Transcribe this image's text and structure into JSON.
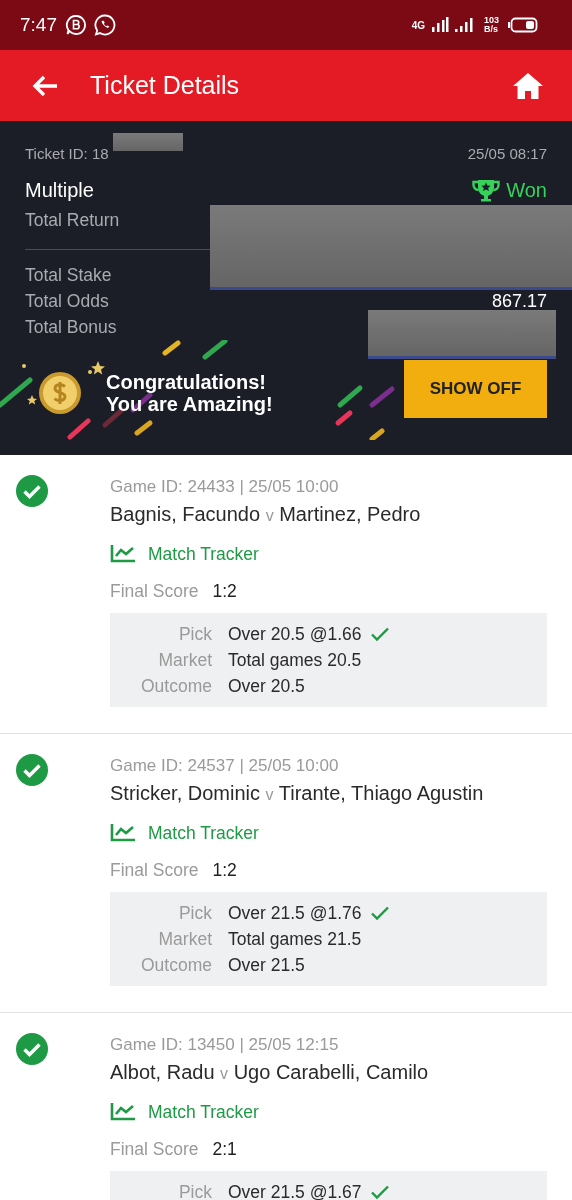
{
  "status_bar": {
    "time": "7:47",
    "network": "4G",
    "speed": {
      "value": "103",
      "unit": "B/s"
    }
  },
  "header": {
    "title": "Ticket Details"
  },
  "ticket": {
    "id": {
      "text": "Ticket ID: 18",
      "redacted": true
    },
    "date": "25/05 08:17",
    "type": "Multiple",
    "status": "Won",
    "totals": [
      {
        "label": "Total Return"
      },
      {
        "label": "Total Stake"
      },
      {
        "label": "Total Odds",
        "value": "867.17"
      },
      {
        "label": "Total Bonus"
      }
    ],
    "return_stake_redacted": true,
    "bonus_redacted": true
  },
  "banner": {
    "lines": [
      "Congratulations!",
      "You are Amazing!"
    ],
    "button": "SHOW OFF"
  },
  "selections": [
    {
      "won": true,
      "game": "Game ID: 24433 | 25/05 10:00",
      "home": "Bagnis, Facundo",
      "vs": "v",
      "away": "Martinez, Pedro",
      "tracker": "Match Tracker",
      "score_label": "Final Score",
      "score": "1:2",
      "details": [
        {
          "label": "Pick",
          "value": "Over 20.5 @1.66",
          "correct": true
        },
        {
          "label": "Market",
          "value": "Total games 20.5"
        },
        {
          "label": "Outcome",
          "value": "Over 20.5"
        }
      ]
    },
    {
      "won": true,
      "game": "Game ID: 24537 | 25/05 10:00",
      "home": "Stricker, Dominic",
      "vs": "v",
      "away": "Tirante, Thiago Agustin",
      "tracker": "Match Tracker",
      "score_label": "Final Score",
      "score": "1:2",
      "details": [
        {
          "label": "Pick",
          "value": "Over 21.5 @1.76",
          "correct": true
        },
        {
          "label": "Market",
          "value": "Total games 21.5"
        },
        {
          "label": "Outcome",
          "value": "Over 21.5"
        }
      ]
    },
    {
      "won": true,
      "game": "Game ID: 13450 | 25/05 12:15",
      "home": "Albot, Radu",
      "vs": "v",
      "away": "Ugo Carabelli, Camilo",
      "tracker": "Match Tracker",
      "score_label": "Final Score",
      "score": "2:1",
      "details": [
        {
          "label": "Pick",
          "value": "Over 21.5 @1.67",
          "correct": true
        }
      ]
    }
  ]
}
